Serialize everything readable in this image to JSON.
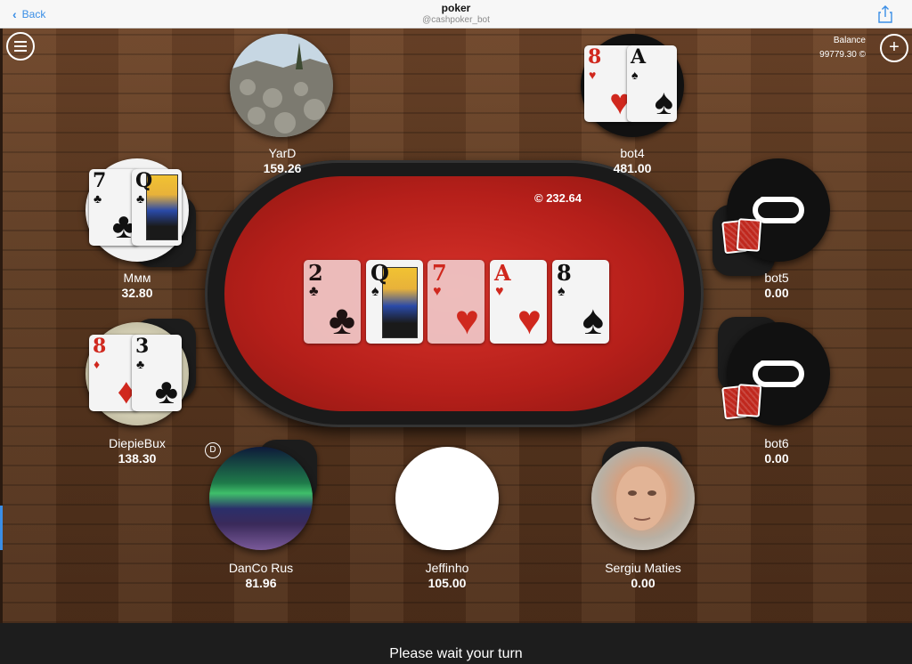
{
  "header": {
    "back_label": "Back",
    "title": "poker",
    "subtitle": "@cashpoker_bot"
  },
  "balance": {
    "label": "Balance",
    "value": "99779.30 ©"
  },
  "pot": "© 232.64",
  "board": [
    {
      "rank": "2",
      "suit": "♣",
      "color": "black",
      "dim": true
    },
    {
      "rank": "Q",
      "suit": "♠",
      "color": "black",
      "dim": false,
      "face": true
    },
    {
      "rank": "7",
      "suit": "♥",
      "color": "red",
      "dim": true
    },
    {
      "rank": "A",
      "suit": "♥",
      "color": "red",
      "dim": false
    },
    {
      "rank": "8",
      "suit": "♠",
      "color": "black",
      "dim": false
    }
  ],
  "players": {
    "yard": {
      "name": "YarD",
      "stack": "159.26"
    },
    "bot4": {
      "name": "bot4",
      "stack": "481.00",
      "cards": [
        {
          "rank": "8",
          "suit": "♥",
          "color": "red"
        },
        {
          "rank": "A",
          "suit": "♠",
          "color": "black"
        }
      ]
    },
    "mmm": {
      "name": "Ммм",
      "stack": "32.80",
      "cards": [
        {
          "rank": "7",
          "suit": "♣",
          "color": "black"
        },
        {
          "rank": "Q",
          "suit": "♣",
          "color": "black",
          "face": true
        }
      ]
    },
    "bot5": {
      "name": "bot5",
      "stack": "0.00"
    },
    "diepiebux": {
      "name": "DiepieBux",
      "stack": "138.30",
      "cards": [
        {
          "rank": "8",
          "suit": "♦",
          "color": "red"
        },
        {
          "rank": "3",
          "suit": "♣",
          "color": "black"
        }
      ]
    },
    "bot6": {
      "name": "bot6",
      "stack": "0.00"
    },
    "danco": {
      "name": "DanCo Rus",
      "stack": "81.96"
    },
    "jeffinho": {
      "name": "Jeffinho",
      "stack": "105.00"
    },
    "sergiu": {
      "name": "Sergiu Maties",
      "stack": "0.00"
    }
  },
  "dealer_button": "D",
  "status_text": "Please wait your turn",
  "colors": {
    "felt": "#b51f1a",
    "accent": "#3a8ee6"
  }
}
